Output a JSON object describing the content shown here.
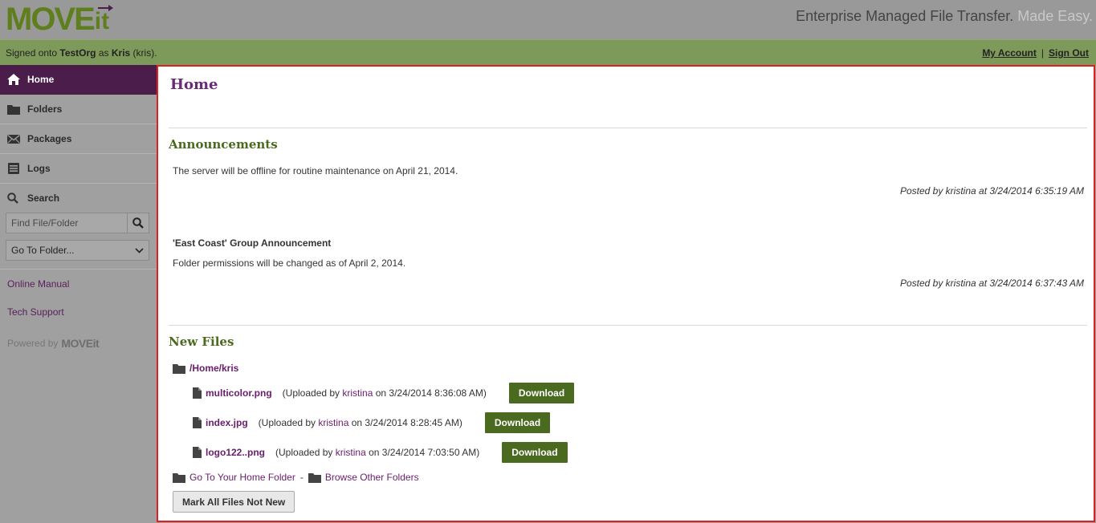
{
  "header": {
    "logo_main": "MOVE",
    "logo_it": "it",
    "tagline_main": "Enterprise Managed File Transfer.",
    "tagline_easy": "Made Easy."
  },
  "userbar": {
    "signed_prefix": "Signed onto ",
    "org": "TestOrg",
    "as_text": " as ",
    "user": "Kris",
    "username": " (kris).",
    "my_account": "My Account",
    "separator": "|",
    "sign_out": "Sign Out"
  },
  "sidebar": {
    "items": [
      {
        "label": "Home",
        "icon": "home-icon"
      },
      {
        "label": "Folders",
        "icon": "folder-icon"
      },
      {
        "label": "Packages",
        "icon": "envelope-icon"
      },
      {
        "label": "Logs",
        "icon": "log-icon"
      }
    ],
    "search_label": "Search",
    "search_placeholder": "Find File/Folder",
    "folder_select_value": "Go To Folder...",
    "online_manual": "Online Manual",
    "tech_support": "Tech Support",
    "powered_by": "Powered by",
    "powered_logo": "MOVEit"
  },
  "main": {
    "title": "Home",
    "announcements_title": "Announcements",
    "announcements": [
      {
        "heading": "",
        "text": "The server will be offline for routine maintenance on April 21, 2014.",
        "posted": "Posted by kristina at 3/24/2014 6:35:19 AM"
      },
      {
        "heading": "'East Coast' Group Announcement",
        "text": "Folder permissions will be changed as of April 2, 2014.",
        "posted": "Posted by kristina at 3/24/2014 6:37:43 AM"
      }
    ],
    "new_files_title": "New Files",
    "folder_path": "/Home/kris",
    "files": [
      {
        "name": "multicolor.png",
        "uploaded_prefix": "(Uploaded by ",
        "uploader": "kristina",
        "uploaded_suffix": " on 3/24/2014 8:36:08 AM)",
        "button": "Download"
      },
      {
        "name": "index.jpg",
        "uploaded_prefix": "(Uploaded by ",
        "uploader": "kristina",
        "uploaded_suffix": " on 3/24/2014 8:28:45 AM)",
        "button": "Download"
      },
      {
        "name": "logo122..png",
        "uploaded_prefix": "(Uploaded by ",
        "uploader": "kristina",
        "uploaded_suffix": " on 3/24/2014 7:03:50 AM)",
        "button": "Download"
      }
    ],
    "go_home": "Go To Your Home Folder",
    "dash": "-",
    "browse_other": "Browse Other Folders",
    "mark_all": "Mark All Files Not New"
  },
  "colors": {
    "brand_green": "#5f7f1e",
    "nav_active": "#4a1d4b",
    "title_purple": "#6a2a7a",
    "section_green": "#4b6a1e",
    "button_green": "#4a6a20",
    "highlight_border": "#e02020"
  }
}
